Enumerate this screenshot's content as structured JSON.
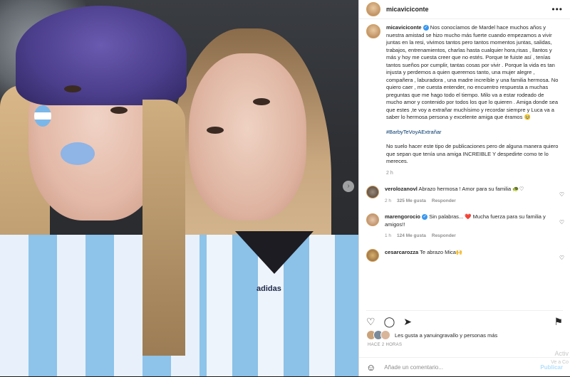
{
  "post": {
    "username": "micaviciconte",
    "caption_user": "micaviciconte",
    "caption_text": "Nos conocíamos de Mardel hace muchos años y nuestra amistad se hizo mucho más fuerte cuando empezamos a vivir juntas en la resi, vivimos tantos pero tantos momentos juntas, salidas, trabajos, entrenamientos, charlas hasta cualquier hora,risas , llantos y más y hoy me cuesta creer que no estés. Porque te fuiste así , tenías tantos sueños por cumplir, tantas cosas por vivir . Porque la vida es tan injusta y perdemos a quien queremos tanto, una mujer alegre , compañera , laburadora , una madre increíble y una familia hermosa. No quiero caer , me cuesta entender, no encuentro respuesta a muchas preguntas que me hago todo el tiempo. Milo va a estar rodeado de mucho amor y contenido por todos los que lo quieren . Amiga donde sea que estes ,te voy a extrañar muchísimo y recordar siempre y Luca va a saber lo hermosa persona y excelente amiga que éramos 🥹",
    "hashtag": "#BarbyTeVoyAExtrañar",
    "caption_text2": "No suelo hacer este tipo de publicaciones pero de alguna manera quiero que sepan que tenía una amiga INCREIBLE Y despedirte como te lo mereces.",
    "caption_time": "2 h",
    "comments": [
      {
        "user": "verolozanovl",
        "text": "Abrazo hermosa ! Amor para su familia 🐢♡",
        "time": "2 h",
        "likes": "325 Me gusta",
        "reply": "Responder"
      },
      {
        "user": "marengorocio",
        "text": "Sin palabras... ❤️ Mucha fuerza para su familia y amigos!!",
        "time": "1 h",
        "likes": "124 Me gusta",
        "reply": "Responder"
      },
      {
        "user": "cesarcarozza",
        "text": "Te abrazo Mica🙌",
        "time": "",
        "likes": "",
        "reply": ""
      }
    ],
    "liked_by": "Les gusta a yanuingravallo y personas más",
    "time_ago": "HACE 2 HORAS",
    "add_comment_placeholder": "Añade un comentario...",
    "publish_label": "Publicar",
    "photo_brand": "adidas"
  },
  "overlay": {
    "activate_line1": "Activ",
    "activate_line2": "Ve a Co"
  },
  "icons": {
    "like": "heart-icon",
    "comment": "comment-icon",
    "share": "send-icon",
    "save": "bookmark-icon",
    "emoji": "emoji-icon",
    "more": "more-icon"
  }
}
